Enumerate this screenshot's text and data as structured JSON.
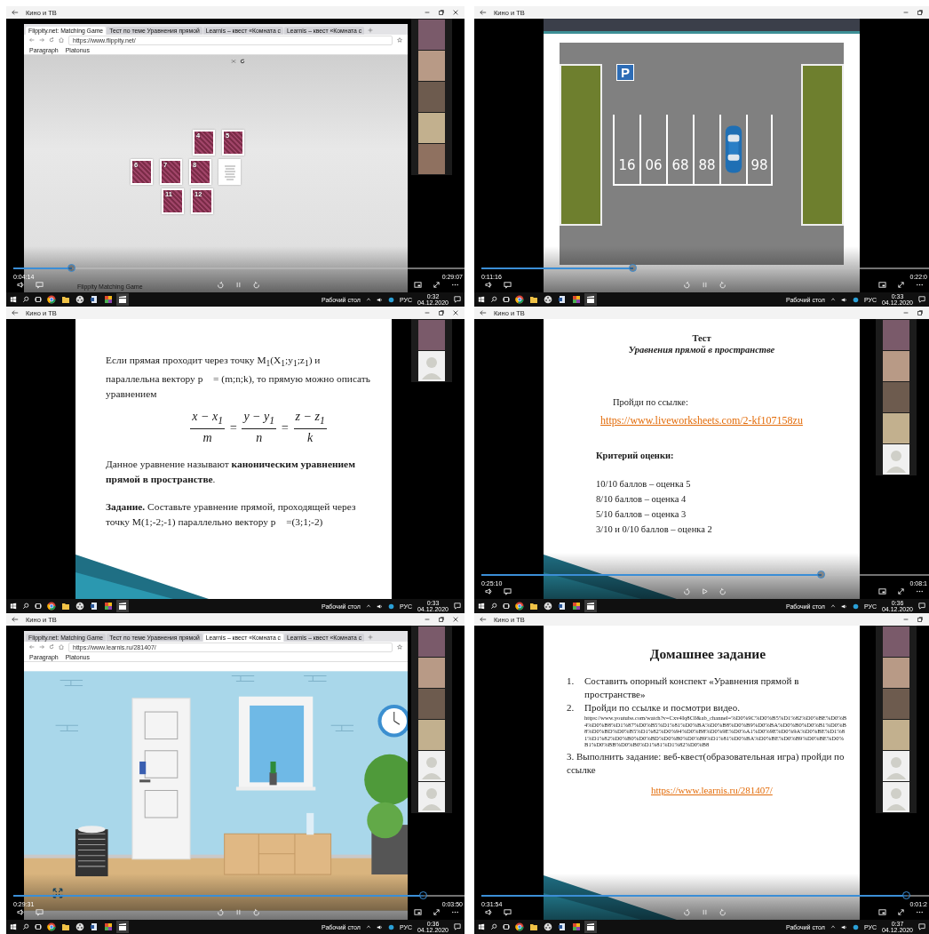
{
  "panels": [
    {
      "window_title": "Кино и ТВ",
      "content": {
        "kind": "browser_game",
        "tabs": [
          {
            "label": "Flippity.net: Matching Game",
            "selected": true
          },
          {
            "label": "Тест по теме Уравнения прямой",
            "selected": false
          },
          {
            "label": "Learnis – квест «Комната с",
            "selected": false
          },
          {
            "label": "Learnis – квест «Комната с",
            "selected": false
          }
        ],
        "url": "https://www.flippity.net/",
        "bookmarks": [
          "Paragraph",
          "Platonus"
        ],
        "card_rows": [
          [
            {
              "number": "4",
              "face_up": false
            },
            {
              "number": "5",
              "face_up": false
            }
          ],
          [
            {
              "number": "6",
              "face_up": false
            },
            {
              "number": "7",
              "face_up": false
            },
            {
              "number": "8",
              "face_up": false
            },
            {
              "face_up": true
            }
          ],
          [
            {
              "number": "11",
              "face_up": false
            },
            {
              "number": "12",
              "face_up": false
            }
          ]
        ],
        "footer": "Flippity Matching Game"
      },
      "participants": [
        {
          "kind": "camera"
        },
        {
          "kind": "camera"
        },
        {
          "kind": "camera"
        },
        {
          "kind": "camera"
        },
        {
          "kind": "camera"
        }
      ],
      "player": {
        "elapsed": "0:04:14",
        "remaining": "0:29:07",
        "level": 0.13,
        "playing": true
      },
      "taskbar": {
        "desktop_label": "Рабочий стол",
        "language": "РУС",
        "time": "0:32",
        "date": "04.12.2020"
      }
    },
    {
      "window_title": "Кино и ТВ",
      "content": {
        "kind": "parking",
        "sign": "P",
        "spots": [
          {
            "label": "16",
            "occupied": false
          },
          {
            "label": "06",
            "occupied": false
          },
          {
            "label": "68",
            "occupied": false
          },
          {
            "label": "88",
            "occupied": false
          },
          {
            "occupied": true
          },
          {
            "label": "98",
            "occupied": false
          }
        ]
      },
      "player": {
        "elapsed": "0:11:16",
        "remaining": "0:22:0",
        "level": 0.34,
        "playing": true
      },
      "taskbar": {
        "desktop_label": "Рабочий стол",
        "language": "РУС",
        "time": "0:33",
        "date": "04.12.2020"
      }
    },
    {
      "window_title": "Кино и ТВ",
      "content": {
        "kind": "slide_text",
        "blocks": [
          {
            "kind": "paragraph",
            "text": "Если прямая проходит через точку M$_{1}$(X$_{1}$;y$_{1}$;z$_{1}$) и параллельна вектору p⃗ = (m;n;k),  то прямую можно описать уравнением"
          },
          {
            "kind": "formula",
            "relation": "=",
            "fractions": [
              {
                "numerator": "x − x$_{1}$",
                "denominator": "m"
              },
              {
                "numerator": "y − y$_{1}$",
                "denominator": "n"
              },
              {
                "numerator": "z − z$_{1}$",
                "denominator": "k"
              }
            ]
          },
          {
            "kind": "paragraph",
            "text": "Данное уравнение называют **каноническим уравнением прямой в пространстве**."
          },
          {
            "kind": "paragraph",
            "text": "**Задание.** Составьте  уравнение прямой, проходящей через точку М(1;-2;-1) параллельно вектору  p⃗ =(3;1;-2)"
          }
        ]
      },
      "participants": [
        {
          "kind": "camera"
        },
        {
          "kind": "avatar"
        }
      ],
      "taskbar": {
        "desktop_label": "Рабочий стол",
        "language": "РУС",
        "time": "0:33",
        "date": "04.12.2020"
      }
    },
    {
      "window_title": "Кино и ТВ",
      "content": {
        "kind": "test",
        "title": "Тест",
        "subtitle": "Уравнения прямой в пространстве",
        "prompt": "Пройди по ссылке:",
        "link": "https://www.liveworksheets.com/2-kf107158zu",
        "criteria_title": "Критерий оценки:",
        "criteria": [
          "10/10 баллов – оценка 5",
          "8/10 баллов – оценка 4",
          "5/10 баллов – оценка 3",
          "3/10 и 0/10 баллов – оценка 2"
        ]
      },
      "participants": [
        {
          "kind": "camera"
        },
        {
          "kind": "camera"
        },
        {
          "kind": "camera"
        },
        {
          "kind": "camera"
        },
        {
          "kind": "avatar"
        }
      ],
      "player": {
        "elapsed": "0:25:10",
        "remaining": "0:08:1",
        "level": 0.76,
        "playing": false
      },
      "taskbar": {
        "desktop_label": "Рабочий стол",
        "language": "РУС",
        "time": "0:36",
        "date": "04.12.2020"
      }
    },
    {
      "window_title": "Кино и ТВ",
      "content": {
        "kind": "room",
        "tabs": [
          {
            "label": "Flippity.net: Matching Game",
            "selected": false
          },
          {
            "label": "Тест по теме Уравнения прямой",
            "selected": false
          },
          {
            "label": "Learnis – квест «Комната с",
            "selected": true
          },
          {
            "label": "Learnis – квест «Комната с",
            "selected": false
          }
        ],
        "url": "https://www.learnis.ru/281407/",
        "bookmarks": [
          "Paragraph",
          "Platonus"
        ]
      },
      "participants": [
        {
          "kind": "camera"
        },
        {
          "kind": "camera"
        },
        {
          "kind": "camera"
        },
        {
          "kind": "camera"
        },
        {
          "kind": "avatar"
        },
        {
          "kind": "avatar"
        }
      ],
      "player": {
        "elapsed": "0:29:31",
        "remaining": "0:03:50",
        "level": 0.91,
        "playing": true
      },
      "taskbar": {
        "desktop_label": "Рабочий стол",
        "language": "РУС",
        "time": "0:36",
        "date": "04.12.2020"
      }
    },
    {
      "window_title": "Кино и ТВ",
      "content": {
        "kind": "homework",
        "title": "Домашнее задание",
        "items": [
          {
            "number": "1.",
            "text": "Составить опорный конспект «Уравнения прямой в пространстве»"
          },
          {
            "number": "2.",
            "text": "Пройди по ссылке и посмотри видео.",
            "url": "https://www.youtube.com/watch?v=Cxv4Iq8C0&ab_channel=%D0%9C%D0%B5%D1%82%D0%BE%D0%B4%D0%B8%D1%87%D0%B5%D1%81%D0%BA%D0%B8%D0%B9%D0%BA%D0%B0%D0%B1%D0%B8%D0%BD%D0%B5%D1%82%D0%94%D0%B8%D0%9E%D0%A1%D0%9E%D0%9A%D0%BE%D1%81%D1%82%D0%B0%D0%BD%D0%B0%D0%B9%D1%81%D0%BA%D0%BE%D0%B9%D0%BE%D0%B1%D0%BB%D0%B0%D1%81%D1%82%D0%B8"
          }
        ],
        "task": "3. Выполнить задание: веб-квест(образовательная игра) пройди по ссылке",
        "link": "https://www.learnis.ru/281407/"
      },
      "participants": [
        {
          "kind": "camera"
        },
        {
          "kind": "camera"
        },
        {
          "kind": "camera"
        },
        {
          "kind": "camera"
        },
        {
          "kind": "avatar"
        },
        {
          "kind": "avatar"
        }
      ],
      "player": {
        "elapsed": "0:31:54",
        "remaining": "0:01:2",
        "level": 0.95,
        "playing": true
      },
      "taskbar": {
        "desktop_label": "Рабочий стол",
        "language": "РУС",
        "time": "0:37",
        "date": "04.12.2020"
      }
    }
  ]
}
